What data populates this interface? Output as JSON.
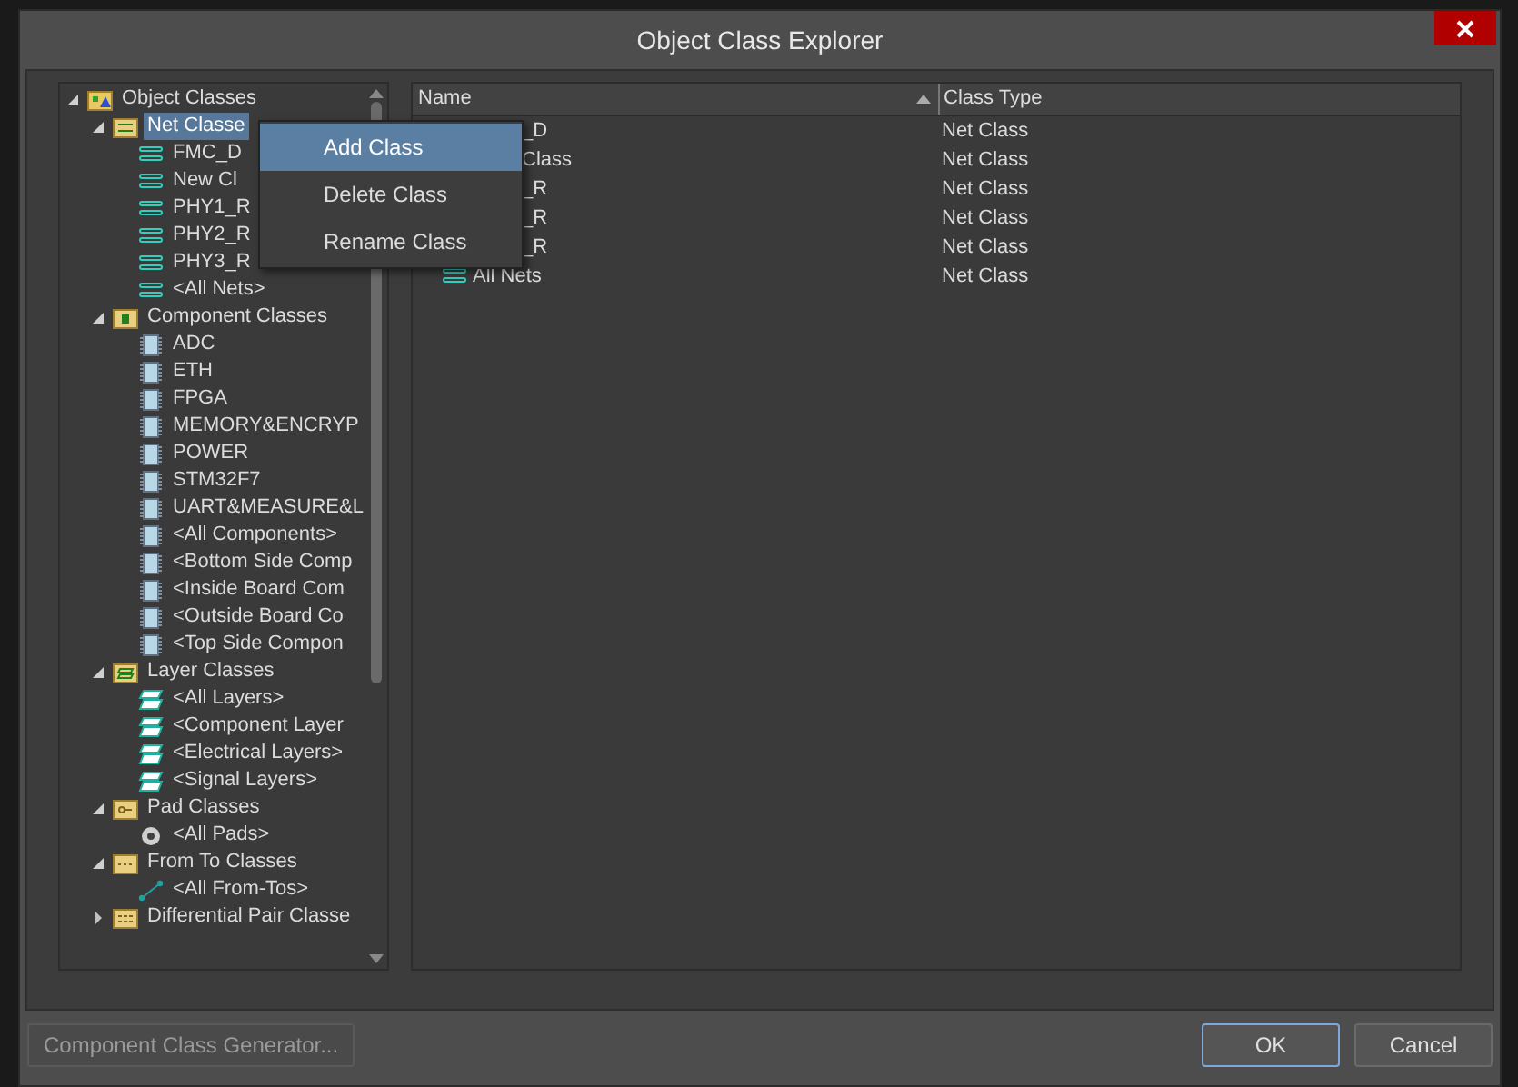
{
  "window": {
    "title": "Object Class Explorer"
  },
  "tree": [
    {
      "label": "Object Classes",
      "kind": "root",
      "expanded": true,
      "selected": false,
      "children": [
        {
          "label": "Net Classe",
          "kind": "net-folder",
          "expanded": true,
          "selected": true,
          "children": [
            {
              "label": "FMC_D",
              "kind": "net",
              "selected": false
            },
            {
              "label": "New Cl",
              "kind": "net",
              "selected": false
            },
            {
              "label": "PHY1_R",
              "kind": "net",
              "selected": false
            },
            {
              "label": "PHY2_R",
              "kind": "net",
              "selected": false
            },
            {
              "label": "PHY3_R",
              "kind": "net",
              "selected": false
            },
            {
              "label": "<All Nets>",
              "kind": "net",
              "selected": false
            }
          ]
        },
        {
          "label": "Component Classes",
          "kind": "component-folder",
          "expanded": true,
          "selected": false,
          "children": [
            {
              "label": "ADC",
              "kind": "component",
              "selected": false
            },
            {
              "label": "ETH",
              "kind": "component",
              "selected": false
            },
            {
              "label": "FPGA",
              "kind": "component",
              "selected": false
            },
            {
              "label": "MEMORY&ENCRYP",
              "kind": "component",
              "selected": false
            },
            {
              "label": "POWER",
              "kind": "component",
              "selected": false
            },
            {
              "label": "STM32F7",
              "kind": "component",
              "selected": false
            },
            {
              "label": "UART&MEASURE&L",
              "kind": "component",
              "selected": false
            },
            {
              "label": "<All Components>",
              "kind": "component",
              "selected": false
            },
            {
              "label": "<Bottom Side Comp",
              "kind": "component",
              "selected": false
            },
            {
              "label": "<Inside Board Com",
              "kind": "component",
              "selected": false
            },
            {
              "label": "<Outside Board Co",
              "kind": "component",
              "selected": false
            },
            {
              "label": "<Top Side Compon",
              "kind": "component",
              "selected": false
            }
          ]
        },
        {
          "label": "Layer Classes",
          "kind": "layer-folder",
          "expanded": true,
          "selected": false,
          "children": [
            {
              "label": "<All Layers>",
              "kind": "layer",
              "selected": false
            },
            {
              "label": "<Component Layer",
              "kind": "layer",
              "selected": false
            },
            {
              "label": "<Electrical Layers>",
              "kind": "layer",
              "selected": false
            },
            {
              "label": "<Signal Layers>",
              "kind": "layer",
              "selected": false
            }
          ]
        },
        {
          "label": "Pad Classes",
          "kind": "pad-folder",
          "expanded": true,
          "selected": false,
          "children": [
            {
              "label": "<All Pads>",
              "kind": "pad",
              "selected": false
            }
          ]
        },
        {
          "label": "From To Classes",
          "kind": "fromto-folder",
          "expanded": true,
          "selected": false,
          "children": [
            {
              "label": "<All From-Tos>",
              "kind": "fromto",
              "selected": false
            }
          ]
        },
        {
          "label": "Differential Pair Classe",
          "kind": "diff-folder",
          "expanded": false,
          "selected": false
        }
      ]
    }
  ],
  "context_menu": [
    {
      "label": "Add Class",
      "selected": true
    },
    {
      "label": "Delete Class",
      "selected": false
    },
    {
      "label": "Rename Class",
      "selected": false
    }
  ],
  "table": {
    "columns": [
      "Name",
      "Class Type"
    ],
    "rows": [
      {
        "name": "_D",
        "class_type": "Net Class",
        "icon": false
      },
      {
        "name": "Class",
        "class_type": "Net Class",
        "icon": false
      },
      {
        "name": "_R",
        "class_type": "Net Class",
        "icon": false
      },
      {
        "name": "_R",
        "class_type": "Net Class",
        "icon": false
      },
      {
        "name": "_R",
        "class_type": "Net Class",
        "icon": false
      },
      {
        "name": "All Nets",
        "class_type": "Net Class",
        "icon": true
      }
    ]
  },
  "buttons": [
    {
      "label": "Component Class Generator...",
      "disabled": true,
      "focused": false
    },
    {
      "label": "OK",
      "disabled": false,
      "focused": true
    },
    {
      "label": "Cancel",
      "disabled": false,
      "focused": false
    }
  ]
}
